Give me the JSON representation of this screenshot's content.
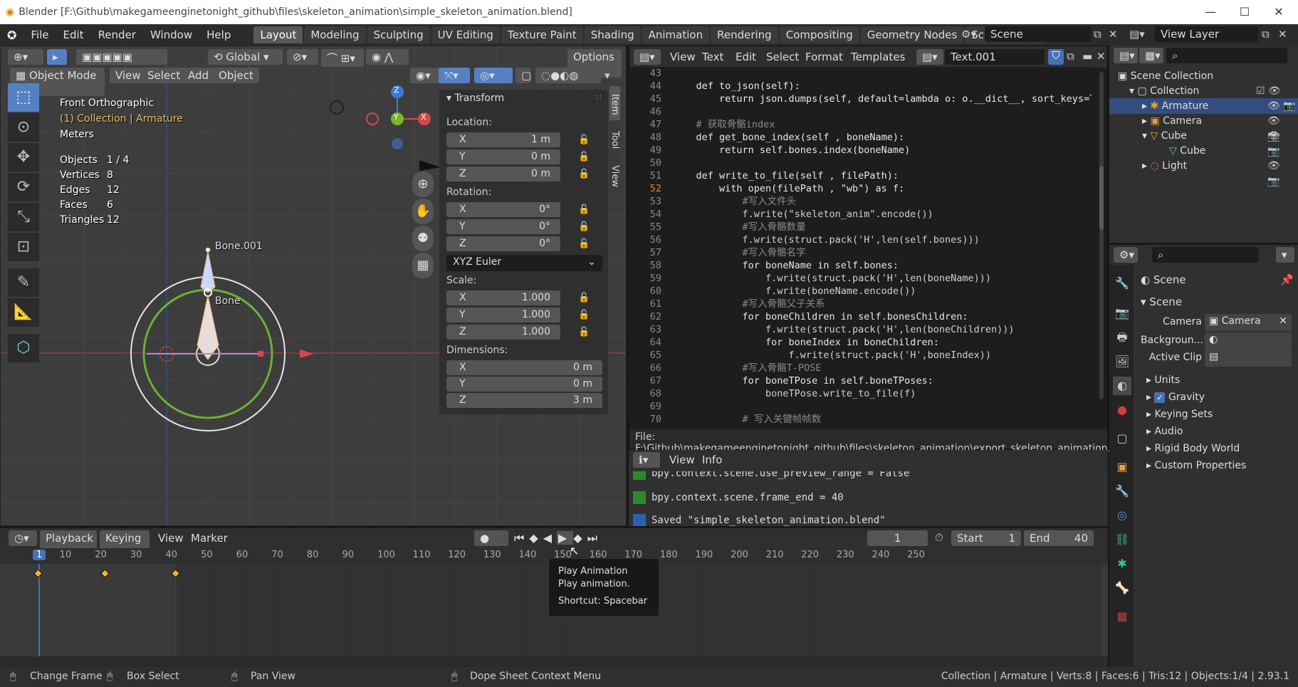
{
  "window": {
    "title": "Blender [F:\\Github\\makegameenginetonight_github\\files\\skeleton_animation\\simple_skeleton_animation.blend]",
    "minimize": "—",
    "maximize": "☐",
    "close": "✕"
  },
  "menu": [
    "File",
    "Edit",
    "Render",
    "Window",
    "Help"
  ],
  "workspaces": [
    "Layout",
    "Modeling",
    "Sculpting",
    "UV Editing",
    "Texture Paint",
    "Shading",
    "Animation",
    "Rendering",
    "Compositing",
    "Geometry Nodes",
    "Scripting"
  ],
  "active_workspace": "Layout",
  "scene_field": "Scene",
  "viewlayer_field": "View Layer",
  "viewport": {
    "mode": "Object Mode",
    "menus": [
      "View",
      "Select",
      "Add",
      "Object"
    ],
    "orientation": "Global",
    "options": "Options",
    "view_name": "Front Orthographic",
    "collection_path": "(1) Collection | Armature",
    "units": "Meters",
    "stats": [
      [
        "Objects",
        "1 / 4"
      ],
      [
        "Vertices",
        "8"
      ],
      [
        "Edges",
        "12"
      ],
      [
        "Faces",
        "6"
      ],
      [
        "Triangles",
        "12"
      ]
    ],
    "bone1": "Bone.001",
    "bone0": "Bone",
    "gizmo": {
      "z": "Z",
      "y": "Y",
      "x": "X"
    },
    "side_tabs": [
      "Item",
      "Tool",
      "View"
    ]
  },
  "transform": {
    "title": "Transform",
    "location_label": "Location:",
    "rotation_label": "Rotation:",
    "scale_label": "Scale:",
    "dimensions_label": "Dimensions:",
    "location": [
      [
        "X",
        "1 m"
      ],
      [
        "Y",
        "0 m"
      ],
      [
        "Z",
        "0 m"
      ]
    ],
    "rotation": [
      [
        "X",
        "0°"
      ],
      [
        "Y",
        "0°"
      ],
      [
        "Z",
        "0°"
      ]
    ],
    "rotation_mode": "XYZ Euler",
    "scale": [
      [
        "X",
        "1.000"
      ],
      [
        "Y",
        "1.000"
      ],
      [
        "Z",
        "1.000"
      ]
    ],
    "dimensions": [
      [
        "X",
        "0 m"
      ],
      [
        "Y",
        "0 m"
      ],
      [
        "Z",
        "3 m"
      ]
    ]
  },
  "text_editor": {
    "menus": [
      "View",
      "Text",
      "Edit",
      "Select",
      "Format",
      "Templates"
    ],
    "filename": "Text.001",
    "filepath": "File: F:\\Github\\makegameenginetonight_github\\files\\skeleton_animation\\export_skeleton_animation.py",
    "current_line": "52",
    "lines": [
      [
        "43",
        ""
      ],
      [
        "44",
        "    def to_json(self):"
      ],
      [
        "45",
        "        return json.dumps(self, default=lambda o: o.__dict__, sort_keys=True"
      ],
      [
        "46",
        ""
      ],
      [
        "47",
        "    # 获取骨骼index"
      ],
      [
        "48",
        "    def get_bone_index(self , boneName):"
      ],
      [
        "49",
        "        return self.bones.index(boneName)"
      ],
      [
        "50",
        ""
      ],
      [
        "51",
        "    def write_to_file(self , filePath):"
      ],
      [
        "52",
        "        with open(filePath , \"wb\") as f:"
      ],
      [
        "53",
        "            #写入文件头"
      ],
      [
        "54",
        "            f.write(\"skeleton_anim\".encode())"
      ],
      [
        "55",
        "            #写入骨骼数量"
      ],
      [
        "56",
        "            f.write(struct.pack('H',len(self.bones)))"
      ],
      [
        "57",
        "            #写入骨骼名字"
      ],
      [
        "58",
        "            for boneName in self.bones:"
      ],
      [
        "59",
        "                f.write(struct.pack('H',len(boneName)))"
      ],
      [
        "60",
        "                f.write(boneName.encode())"
      ],
      [
        "61",
        "            #写入骨骼父子关系"
      ],
      [
        "62",
        "            for boneChildren in self.bonesChildren:"
      ],
      [
        "63",
        "                f.write(struct.pack('H',len(boneChildren)))"
      ],
      [
        "64",
        "                for boneIndex in boneChildren:"
      ],
      [
        "65",
        "                    f.write(struct.pack('H',boneIndex))"
      ],
      [
        "66",
        "            #写入骨骼T-POSE"
      ],
      [
        "67",
        "            for boneTPose in self.boneTPoses:"
      ],
      [
        "68",
        "                boneTPose.write_to_file(f)"
      ],
      [
        "69",
        ""
      ],
      [
        "70",
        "            # 写入关键帧帧数"
      ]
    ]
  },
  "info": {
    "menus": [
      "View",
      "Info"
    ],
    "lines": [
      "bpy.context.scene.use_preview_range = False",
      "bpy.context.scene.frame_end = 40",
      "Saved \"simple_skeleton_animation.blend\""
    ]
  },
  "timeline": {
    "menus": [
      "Playback",
      "Keying",
      "View",
      "Marker"
    ],
    "current_frame": "1",
    "start_label": "Start",
    "start": "1",
    "end_label": "End",
    "end": "40",
    "ruler": [
      "1",
      "10",
      "20",
      "30",
      "40",
      "50",
      "60",
      "70",
      "80",
      "90",
      "100",
      "110",
      "120",
      "130",
      "140",
      "150",
      "160",
      "170",
      "180",
      "190",
      "200",
      "210",
      "220",
      "230",
      "240",
      "250"
    ],
    "keyframes": [
      1,
      20,
      40
    ]
  },
  "tooltip": {
    "title": "Play Animation",
    "desc": "Play animation.",
    "shortcut": "Shortcut: Spacebar"
  },
  "outliner": {
    "root": "Scene Collection",
    "items": [
      [
        "Collection",
        0
      ],
      [
        "Armature",
        1
      ],
      [
        "Camera",
        1
      ],
      [
        "Cube",
        1
      ],
      [
        "Cube",
        2
      ],
      [
        "Light",
        1
      ]
    ]
  },
  "properties": {
    "header": "Scene",
    "section": "Scene",
    "camera_label": "Camera",
    "camera_value": "Camera",
    "background_label": "Backgroun...",
    "clip_label": "Active Clip",
    "panels": [
      "Units",
      "Gravity",
      "Keying Sets",
      "Audio",
      "Rigid Body World",
      "Custom Properties"
    ]
  },
  "status": {
    "left1": "Change Frame",
    "left2": "Box Select",
    "left3": "Pan View",
    "left4": "Dope Sheet Context Menu",
    "right": "Collection | Armature | Verts:8 | Faces:6 | Tris:12 | Objects:1/4 | 2.93.1"
  },
  "colors": {
    "accent": "#4772b3",
    "bone_active": "#c8e0ff",
    "x_axis": "#d94848",
    "y_axis": "#78b828",
    "z_axis": "#3c78d8",
    "keyframe": "#f0b030",
    "collection_text": "#e8c060"
  }
}
